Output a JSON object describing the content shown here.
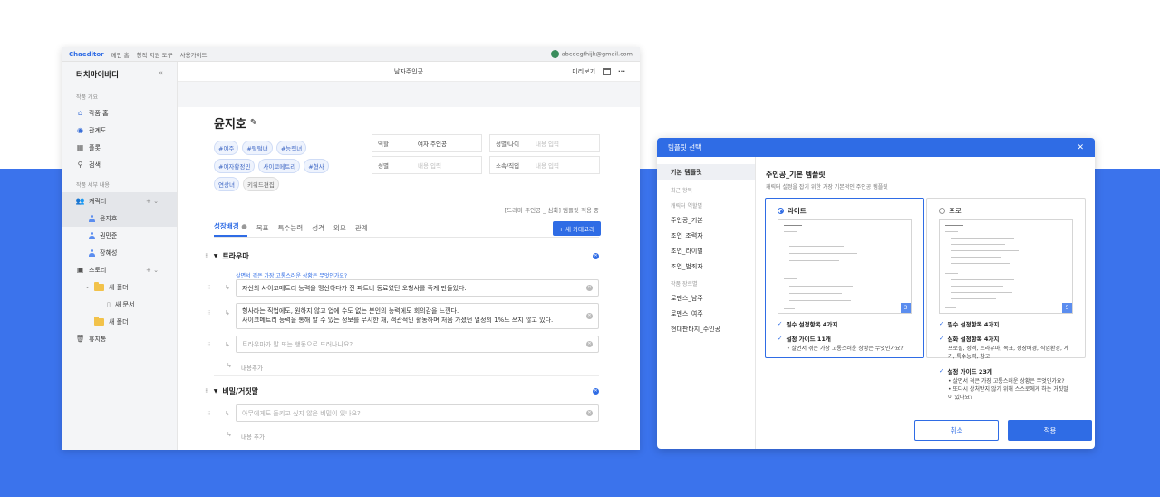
{
  "colors": {
    "accent": "#2f6ce5",
    "band": "#3b73ec",
    "folder": "#f2c24a"
  },
  "topbar": {
    "brand": "Chaeditor",
    "links": [
      "메인 홈",
      "창작 지원 도구",
      "사용가이드"
    ],
    "email": "abcdegfhijk@gmail.com"
  },
  "sidebar": {
    "title": "터치마이바디",
    "collapse": "«",
    "sec1": "작품 개요",
    "items1": [
      {
        "label": "작품 홈",
        "icon": "home-icon"
      },
      {
        "label": "관계도",
        "icon": "relation-icon"
      },
      {
        "label": "플롯",
        "icon": "plot-icon"
      },
      {
        "label": "검색",
        "icon": "search-icon"
      }
    ],
    "sec2": "작품 세부 내용",
    "character": "캐릭터",
    "chars": [
      "윤지호",
      "권민준",
      "장혜성"
    ],
    "story": "스토리",
    "folder1": "새 폴더",
    "doc1": "새 문서",
    "folder2": "새 폴더",
    "trash": "휴지통"
  },
  "main": {
    "header": "남자주인공",
    "preview": "미리보기",
    "more": "···",
    "name": "윤지호",
    "tags": [
      "#여주",
      "#털털녀",
      "#능력녀",
      "#여자황정민",
      "사이코메트리",
      "#형사",
      "연상녀",
      "키워드편집"
    ],
    "fields": [
      {
        "k": "역할",
        "v": "여자 주인공",
        "filled": true
      },
      {
        "k": "성별/나이",
        "v": "내용 입력",
        "filled": false
      },
      {
        "k": "성별",
        "v": "내용 입력",
        "filled": false
      },
      {
        "k": "소속/직업",
        "v": "내용 입력",
        "filled": false
      }
    ],
    "status": "[드라마 주인공 _ 심화] 템플릿 적용 중",
    "tabs": [
      "성장배경",
      "목표",
      "특수능력",
      "성격",
      "외모",
      "관계"
    ],
    "add_category": "+ 새 카테고리",
    "sec_trauma": "트라우마",
    "hint": "살면서 겪은 가장 고통스러운 상황은 무엇인가요?",
    "ans1": "자신의 사이코메트리 능력을 맹신하다가 전 파트너 동료였던 오형사를 죽게 만들었다.",
    "ans2a": "형사라는 직업에도, 원하지 않고 업에 수도 없는 분인의 능력에도 회의감을 느낀다.",
    "ans2b": "사이코메트리 능력을 통해 알 수 있는 정보를 무시한 채, 객관적인 활동하며 처음 가졌던 열정의 1%도 쓰지 않고 있다.",
    "ph1": "트라우마가 말 또는 행동으로 드러나나요?",
    "add_content": "내용추가",
    "sec_secret": "비밀/거짓말",
    "ph2": "아무에게도 들키고 싶지 않은 비밀이 있나요?",
    "add_content2": "내용 추가"
  },
  "dialog": {
    "title": "템플릿 선택",
    "close": "✕",
    "side": {
      "basic": "기본 템플릿",
      "recent": "최근 항목",
      "role_group": "캐릭터 역할별",
      "roles": [
        "주인공_기본",
        "조연_조력자",
        "조연_라이벌",
        "조연_범죄자"
      ],
      "genre_group": "작품 장르별",
      "genres": [
        "로맨스_남주",
        "로맨스_여주",
        "현대판타지_주인공"
      ]
    },
    "heading": "주인공_기본 템플릿",
    "sub": "캐릭터 설정을 잡기 위한 가장 기본적인 주인공 템플릿",
    "lite": {
      "name": "라이트",
      "count": "3",
      "req": "필수 설정항목 4가지",
      "guide": "설정 가이드 11개",
      "bullet": "살면서 겪은 가장 고통스러운 상황은 무엇인가요?"
    },
    "pro": {
      "name": "프로",
      "count": "5",
      "req": "필수 설정항목 4가지",
      "deep": "심화 설정항목 4가지",
      "deep_desc": "프로필, 성격, 트라우마, 목표, 성장배경, 직업환경, 계기, 특수능력, 참고",
      "guide": "설정 가이드 23개",
      "b1": "살면서 겪은 가장 고통스러운 상황은 무엇인가요?",
      "b2": "또다시 상처받지 않기 위해 스스로에게 하는 거짓말이 있나요?"
    },
    "cancel": "취소",
    "apply": "적용"
  }
}
